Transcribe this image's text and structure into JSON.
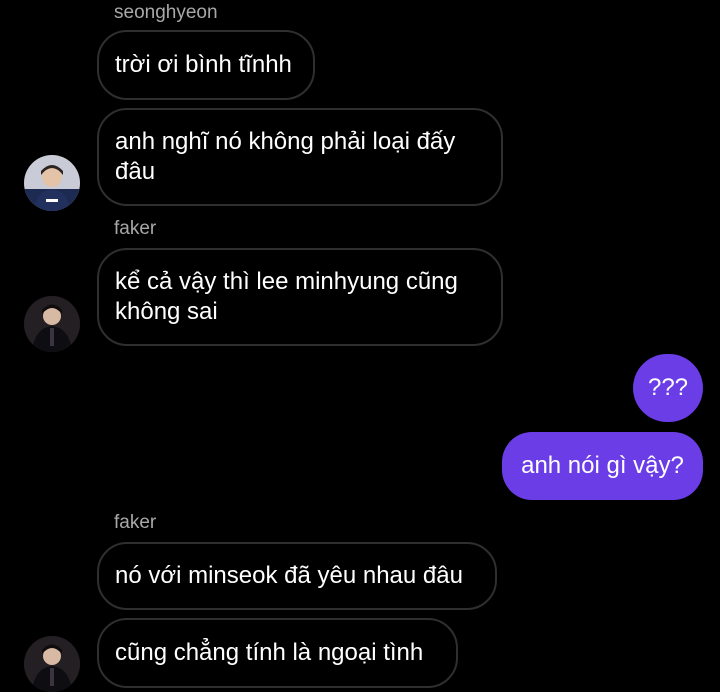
{
  "conversation": {
    "groups": [
      {
        "sender": "seonghyeon",
        "messages": [
          "trời ơi bình tĩnhh",
          "anh nghĩ nó không phải loại đấy\nđâu"
        ]
      },
      {
        "sender": "faker",
        "messages": [
          "kể cả vậy thì lee minhyung cũng\nkhông sai"
        ]
      },
      {
        "sender": "",
        "outgoing": true,
        "messages": [
          "???",
          "anh nói gì vậy?"
        ]
      },
      {
        "sender": "faker",
        "messages": [
          "nó với minseok đã yêu nhau đâu",
          "cũng chẳng tính là ngoại tình"
        ]
      }
    ]
  },
  "colors": {
    "background": "#000000",
    "incoming_border": "#2f2f2f",
    "outgoing_fill": "#6b3de6",
    "sender_name": "#a8a8a8"
  }
}
